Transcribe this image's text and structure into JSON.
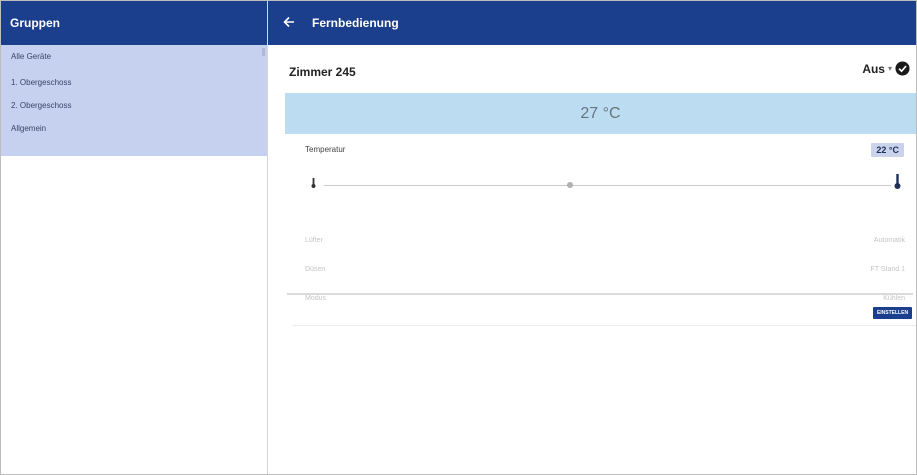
{
  "left_panel": {
    "title": "Gruppen",
    "groups": [
      {
        "label": "Alle Geräte"
      },
      {
        "label": "1. Obergeschoss"
      },
      {
        "label": "2. Obergeschoss"
      },
      {
        "label": "Allgemein"
      }
    ]
  },
  "right_panel": {
    "title": "Fernbedienung",
    "room": "Zimmer 245",
    "power": {
      "label": "Aus",
      "caret": "▾"
    },
    "current_temperature": "27 °C",
    "temperature": {
      "label": "Temperatur",
      "setpoint": "22 °C",
      "slider_level_percent": 47
    },
    "settings": [
      {
        "label": "Lüfter",
        "value": "Automatik"
      },
      {
        "label": "Düsen",
        "value": "FT Stand 1"
      },
      {
        "label": "Modus",
        "value": "Kühlen"
      }
    ],
    "set_button": "EINSTELLEN"
  },
  "icons": {
    "back": "arrow-left-icon",
    "power_state": "check-circle-icon",
    "low_temp": "thermometer-low-icon",
    "high_temp": "thermometer-high-icon"
  },
  "colors": {
    "header_blue": "#1b3f8c",
    "group_list_bg": "#c5d1ee",
    "temp_display_bg": "#bcdcf1"
  }
}
